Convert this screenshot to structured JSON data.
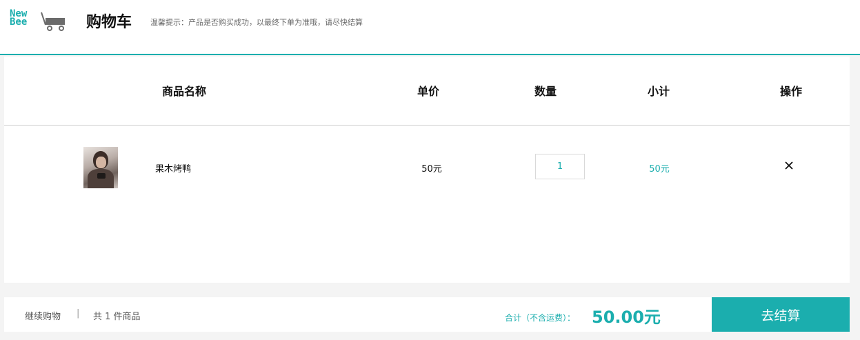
{
  "header": {
    "logo_line1": "New",
    "logo_line2": "Bee",
    "title": "购物车",
    "tip": "温馨提示：产品是否购买成功，以最终下单为准哦，请尽快结算"
  },
  "table": {
    "headers": [
      "商品名称",
      "单价",
      "数量",
      "小计",
      "操作"
    ],
    "rows": [
      {
        "name": "果木烤鸭",
        "price": "50元",
        "quantity": "1",
        "subtotal": "50元"
      }
    ]
  },
  "footer": {
    "continue_label": "继续购物",
    "separator": "|",
    "count_text": "共 1 件商品",
    "total_label": "合计（不含运费）：",
    "total_value": "50.00元",
    "checkout_label": "去结算"
  },
  "colors": {
    "accent": "#1baeae"
  },
  "icons": {
    "logo": "cart-icon",
    "delete": "close-icon"
  }
}
